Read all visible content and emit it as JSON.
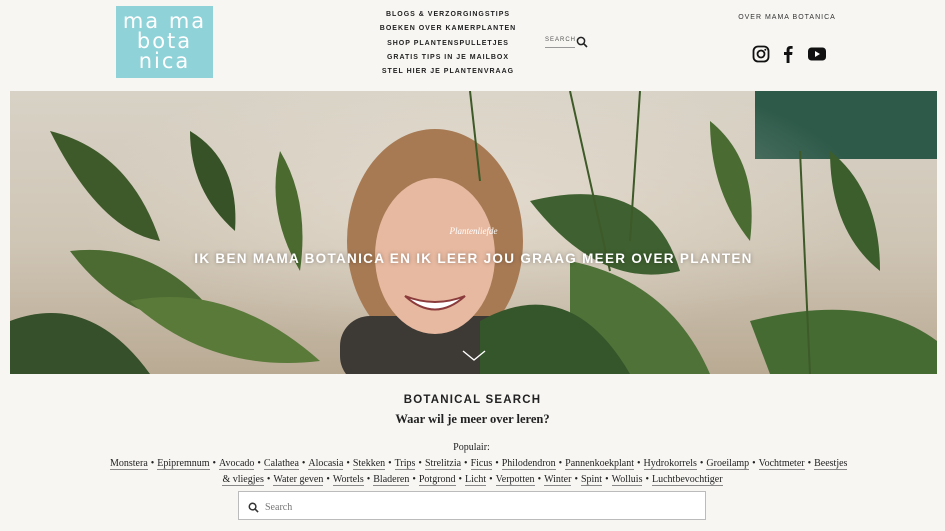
{
  "logo": {
    "lines": [
      "ma ma",
      "bota",
      "nica"
    ]
  },
  "nav": {
    "items": [
      "BLOGS & VERZORGINGSTIPS",
      "BOEKEN OVER KAMERPLANTEN",
      "SHOP PLANTENSPULLETJES",
      "GRATIS TIPS IN JE MAILBOX",
      "STEL HIER JE PLANTENVRAAG"
    ]
  },
  "header": {
    "search_label": "SEARCH",
    "about_link": "OVER MAMA BOTANICA",
    "socials": [
      "instagram-icon",
      "facebook-icon",
      "youtube-icon"
    ]
  },
  "hero": {
    "kicker": "Plantenliefde",
    "headline": "IK BEN MAMA BOTANICA EN IK LEER JOU GRAAG MEER OVER PLANTEN"
  },
  "botanical_search": {
    "title": "BOTANICAL SEARCH",
    "subtitle": "Waar wil je meer over leren?",
    "popular_prefix": "Populair:",
    "tags": [
      "Monstera",
      "Epipremnum",
      "Avocado",
      "Calathea",
      "Alocasia",
      "Stekken",
      "Trips",
      "Strelitzia",
      "Ficus",
      "Philodendron",
      "Pannenkoekplant",
      "Hydrokorrels",
      "Groeilamp",
      "Vochtmeter",
      "Beestjes & vliegjes",
      "Water geven",
      "Wortels",
      "Bladeren",
      "Potgrond",
      "Licht",
      "Verpotten",
      "Winter",
      "Spint",
      "Wolluis",
      "Luchtbevochtiger"
    ],
    "search_placeholder": "Search"
  },
  "colors": {
    "logo_bg": "#8fd2d8",
    "page_bg": "#f7f6f3",
    "accent_green": "#2e5a4a"
  }
}
